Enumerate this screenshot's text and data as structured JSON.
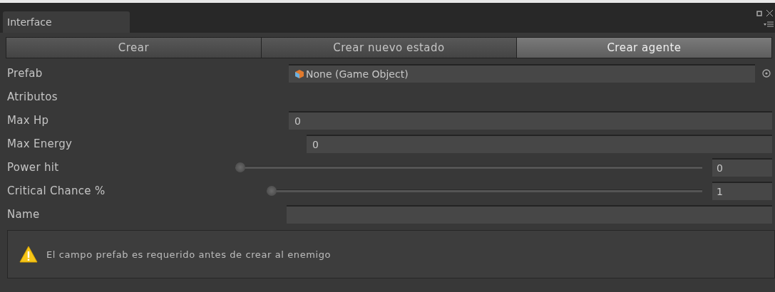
{
  "window": {
    "tab": "Interface"
  },
  "toolbar": [
    {
      "label": "Crear",
      "selected": false
    },
    {
      "label": "Crear nuevo estado",
      "selected": false
    },
    {
      "label": "Crear agente",
      "selected": true
    }
  ],
  "fields": [
    {
      "kind": "object",
      "label": "Prefab",
      "value": "None (Game Object)"
    },
    {
      "kind": "header",
      "label": "Atributos"
    },
    {
      "kind": "int",
      "label": "Max Hp",
      "value": "0"
    },
    {
      "kind": "int",
      "label": "Max Energy",
      "value": "0"
    },
    {
      "kind": "slider",
      "label": "Power hit",
      "level": 0,
      "value": "0"
    },
    {
      "kind": "slider",
      "label": "Critical Chance %",
      "level": 0,
      "value": "1"
    },
    {
      "kind": "text",
      "label": "Name"
    }
  ],
  "help_box": {
    "message": "El campo prefab es requerido antes de crear al enemigo"
  }
}
